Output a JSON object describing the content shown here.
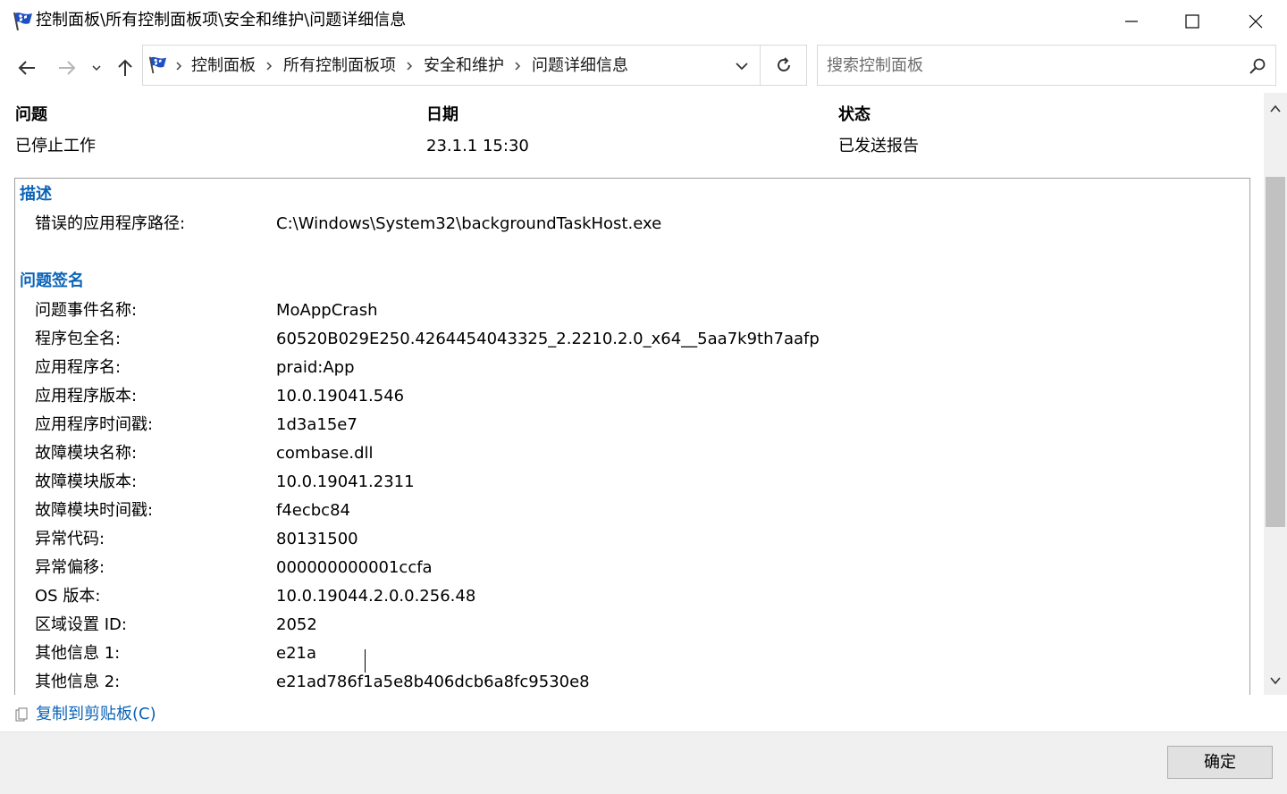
{
  "window": {
    "title": "控制面板\\所有控制面板项\\安全和维护\\问题详细信息"
  },
  "address_bar": {
    "crumbs": [
      "控制面板",
      "所有控制面板项",
      "安全和维护",
      "问题详细信息"
    ]
  },
  "search": {
    "placeholder": "搜索控制面板"
  },
  "header": {
    "problem_label": "问题",
    "problem_value": "已停止工作",
    "date_label": "日期",
    "date_value": "23.1.1 15:30",
    "status_label": "状态",
    "status_value": "已发送报告"
  },
  "description": {
    "title": "描述",
    "path_label": "错误的应用程序路径:",
    "path_value": "C:\\Windows\\System32\\backgroundTaskHost.exe"
  },
  "signature": {
    "title": "问题签名",
    "rows": [
      {
        "label": "问题事件名称:",
        "value": "MoAppCrash"
      },
      {
        "label": "程序包全名:",
        "value": "60520B029E250.4264454043325_2.2210.2.0_x64__5aa7k9th7aafp"
      },
      {
        "label": "应用程序名:",
        "value": "praid:App"
      },
      {
        "label": "应用程序版本:",
        "value": "10.0.19041.546"
      },
      {
        "label": "应用程序时间戳:",
        "value": "1d3a15e7"
      },
      {
        "label": "故障模块名称:",
        "value": "combase.dll"
      },
      {
        "label": "故障模块版本:",
        "value": "10.0.19041.2311"
      },
      {
        "label": "故障模块时间戳:",
        "value": "f4ecbc84"
      },
      {
        "label": "异常代码:",
        "value": "80131500"
      },
      {
        "label": "异常偏移:",
        "value": "000000000001ccfa"
      },
      {
        "label": "OS 版本:",
        "value": "10.0.19044.2.0.0.256.48"
      },
      {
        "label": "区域设置 ID:",
        "value": "2052"
      },
      {
        "label": "其他信息 1:",
        "value": "e21a"
      },
      {
        "label": "其他信息 2:",
        "value": "e21ad786f1a5e8b406dcb6a8fc9530e8"
      }
    ]
  },
  "footer": {
    "copy_link": "复制到剪贴板(C)",
    "ok_button": "确定"
  },
  "colors": {
    "link": "#0b63b7",
    "flag_blue": "#1f4fc4"
  },
  "icons": [
    "flag-icon",
    "minimize-icon",
    "maximize-icon",
    "close-icon",
    "back-arrow-icon",
    "forward-arrow-icon",
    "recent-dropdown-icon",
    "up-arrow-icon",
    "chevron-right-icon",
    "chevron-down-icon",
    "refresh-icon",
    "search-icon",
    "copy-icon"
  ]
}
